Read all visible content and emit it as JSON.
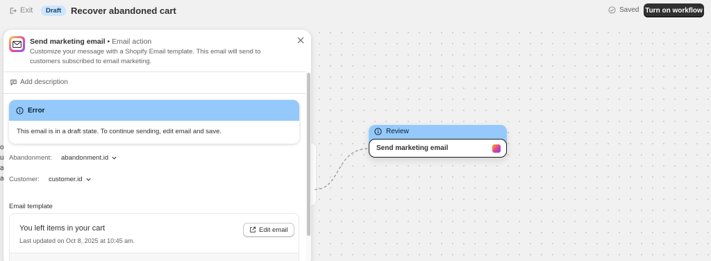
{
  "topbar": {
    "exit_label": "Exit",
    "status_badge": "Draft",
    "title": "Recover abandoned cart",
    "saved_label": "Saved",
    "turn_on_label": "Turn on workflow"
  },
  "canvas": {
    "behind_text": [
      "o",
      "u",
      "a",
      "a"
    ],
    "node": {
      "header": "Review",
      "action": "Send marketing email",
      "header_color": "#95c9fb"
    }
  },
  "panel": {
    "title": "Send marketing email",
    "separator": "•",
    "subtitle": "Email action",
    "description": "Customize your message with a Shopify Email template. This email will send to customers subscribed to email marketing.",
    "add_description": "Add description",
    "error": {
      "title": "Error",
      "message": "This email is in a draft state. To continue sending, edit email and save."
    },
    "fields": [
      {
        "label": "Abandonment:",
        "value": "abandonment.id"
      },
      {
        "label": "Customer:",
        "value": "customer.id"
      }
    ],
    "template_section_label": "Email template",
    "template": {
      "title": "You left items in your cart",
      "updated": "Last updated on Oct 8, 2025 at 10:45 am.",
      "edit_label": "Edit email"
    }
  },
  "colors": {
    "accent_info": "#95c9fb",
    "primary_button": "#303030",
    "badge_bg": "#cde6ff"
  }
}
